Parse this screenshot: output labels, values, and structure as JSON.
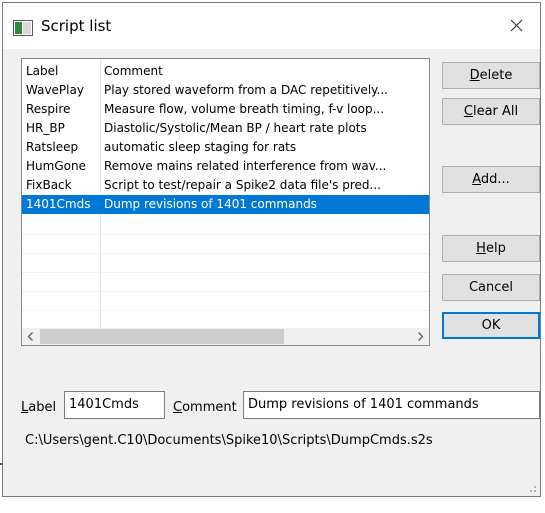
{
  "window": {
    "title": "Script list",
    "close_icon": "close-icon"
  },
  "list": {
    "headers": {
      "label": "Label",
      "comment": "Comment"
    },
    "rows": [
      {
        "label": "WavePlay",
        "comment": "Play stored waveform from a DAC repetitively..."
      },
      {
        "label": "Respire",
        "comment": "Measure flow, volume breath timing, f-v loop..."
      },
      {
        "label": "HR_BP",
        "comment": "Diastolic/Systolic/Mean BP / heart rate plots"
      },
      {
        "label": "Ratsleep",
        "comment": "automatic sleep staging for rats"
      },
      {
        "label": "HumGone",
        "comment": "Remove mains related interference from wav..."
      },
      {
        "label": "FixBack",
        "comment": "Script to test/repair a Spike2 data file's pred..."
      },
      {
        "label": "1401Cmds",
        "comment": "Dump revisions of 1401 commands"
      }
    ],
    "selected_index": 6
  },
  "buttons": {
    "delete": {
      "pre": "",
      "u": "D",
      "post": "elete"
    },
    "clear_all": {
      "pre": "",
      "u": "C",
      "post": "lear All"
    },
    "add": {
      "pre": "",
      "u": "A",
      "post": "dd..."
    },
    "help": {
      "pre": "",
      "u": "H",
      "post": "elp"
    },
    "cancel": {
      "pre": "Cancel",
      "u": "",
      "post": ""
    },
    "ok": {
      "pre": "OK",
      "u": "",
      "post": ""
    }
  },
  "form": {
    "label_caption": {
      "u": "L",
      "post": "abel"
    },
    "label_value": "1401Cmds",
    "comment_caption": {
      "u": "C",
      "post": "omment"
    },
    "comment_value": "Dump revisions of 1401 commands"
  },
  "path": "C:\\Users\\gent.C10\\Documents\\Spike10\\Scripts\\DumpCmds.s2s",
  "colors": {
    "selection": "#0078d7",
    "dialog_bg": "#f0f0f0"
  }
}
